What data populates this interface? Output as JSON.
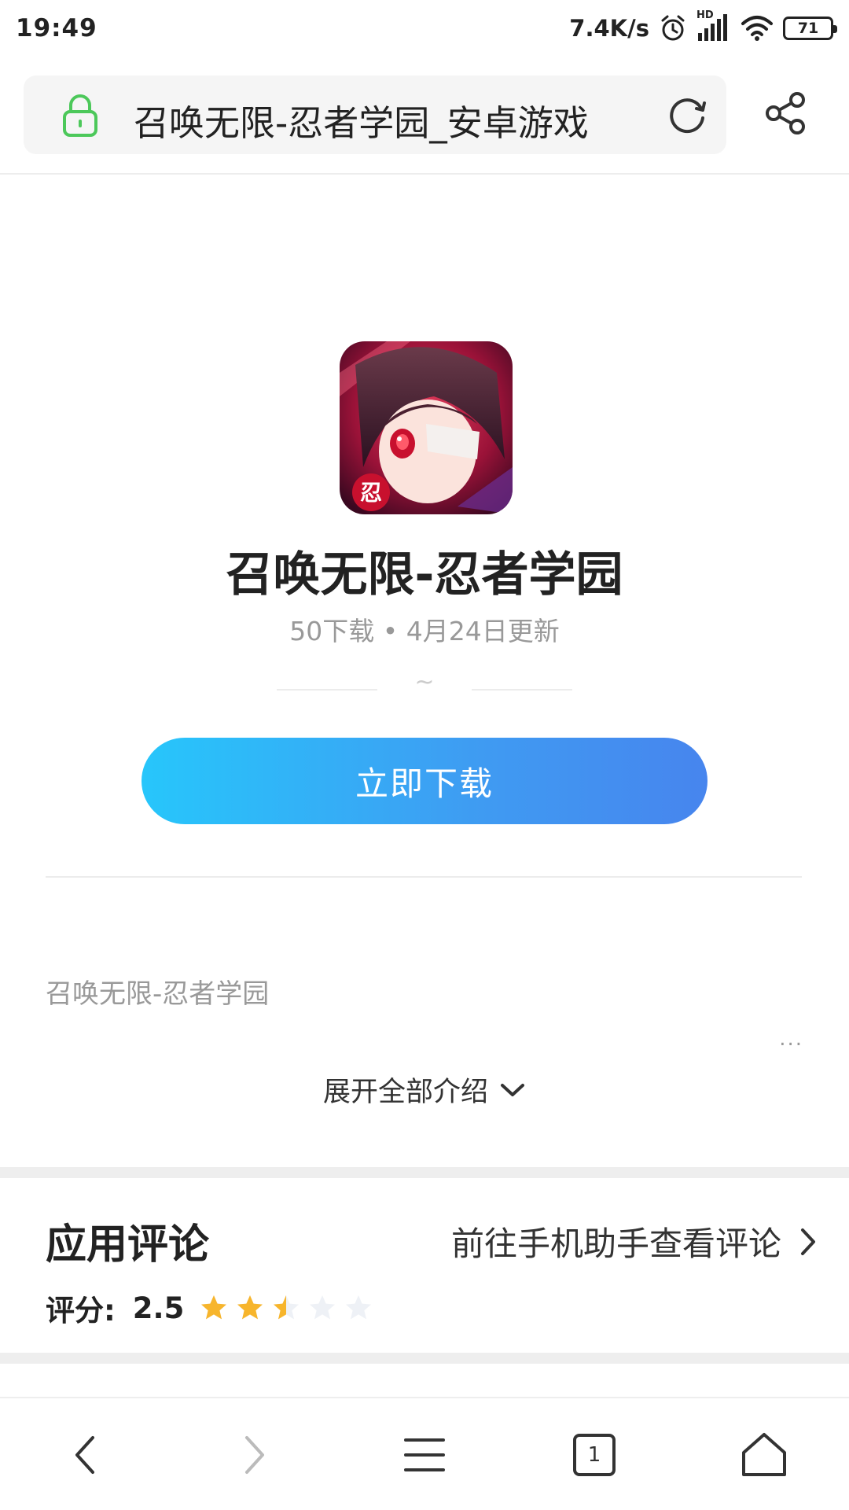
{
  "status_bar": {
    "time": "19:49",
    "net_speed": "7.4K/s",
    "hd_label": "HD",
    "battery": "71"
  },
  "address_bar": {
    "url_text": "召唤无限-忍者学园_安卓游戏"
  },
  "app": {
    "title": "召唤无限-忍者学园",
    "meta": "50下载 • 4月24日更新",
    "tilde": "~",
    "download_label": "立即下载",
    "icon_badge": "忍",
    "intro": "召唤无限-忍者学园",
    "intro_more": "...",
    "expand_label": "展开全部介绍"
  },
  "reviews": {
    "title": "应用评论",
    "link_label": "前往手机助手查看评论",
    "rating_label": "评分:",
    "rating_value": "2.5",
    "rating_score": 2.5,
    "rating_max": 5
  },
  "bottom_nav": {
    "tab_count": "1"
  },
  "colors": {
    "accent_start": "#27c6fb",
    "accent_end": "#4785ee",
    "star_filled": "#f7b52c",
    "star_empty": "#eef1f6",
    "lock_green": "#4cc85a"
  }
}
